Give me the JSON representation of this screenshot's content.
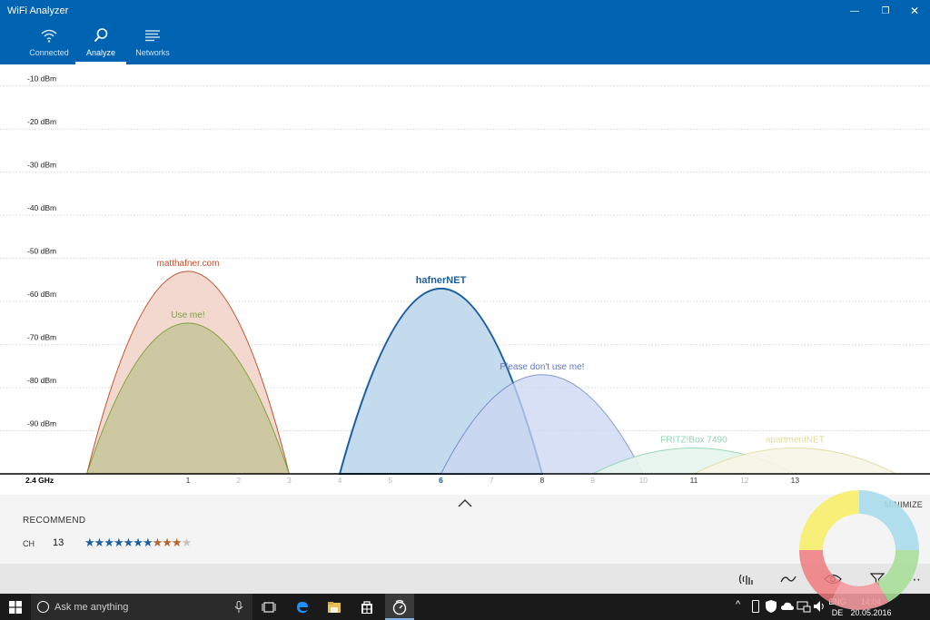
{
  "window": {
    "title": "WiFi Analyzer",
    "minimize_glyph": "—",
    "restore_glyph": "❐",
    "close_glyph": "✕"
  },
  "nav": {
    "tabs": [
      {
        "label": "Connected",
        "icon": "wifi-icon"
      },
      {
        "label": "Analyze",
        "icon": "magnifier-icon"
      },
      {
        "label": "Networks",
        "icon": "list-icon"
      }
    ],
    "active": "Analyze"
  },
  "chart_data": {
    "type": "area",
    "band_label": "2.4 GHz",
    "y_ticks": [
      "-10 dBm",
      "-20 dBm",
      "-30 dBm",
      "-40 dBm",
      "-50 dBm",
      "-60 dBm",
      "-70 dBm",
      "-80 dBm",
      "-90 dBm"
    ],
    "y_values": [
      -10,
      -20,
      -30,
      -40,
      -50,
      -60,
      -70,
      -80,
      -90
    ],
    "ylim": [
      -100,
      -5
    ],
    "x_ticks": [
      "1",
      "2",
      "3",
      "4",
      "5",
      "6",
      "7",
      "8",
      "9",
      "10",
      "11",
      "12",
      "13"
    ],
    "highlight_channel": "6",
    "grid": true,
    "series": [
      {
        "name": "matthafner.com",
        "channel": 1,
        "width": 4,
        "signal": -53,
        "color": "#c0522f",
        "fill": "#f2d8ce",
        "opacity": 1,
        "bold": false
      },
      {
        "name": "Use me!",
        "channel": 1,
        "width": 4,
        "signal": -65,
        "color": "#7ea23e",
        "fill": "#cdc8a2",
        "opacity": 1,
        "bold": false
      },
      {
        "name": "hafnerNET",
        "channel": 6,
        "width": 4,
        "signal": -57,
        "color": "#1b5fa0",
        "fill": "#c4dbee",
        "opacity": 1,
        "bold": true
      },
      {
        "name": "Please don't use me!",
        "channel": 8,
        "width": 4,
        "signal": -77,
        "color": "#5d76c4",
        "fill": "#ccd6f3",
        "opacity": 0.75,
        "bold": false
      },
      {
        "name": "FRITZ!Box 7490",
        "channel": 11,
        "width": 4,
        "signal": -94,
        "color": "#8fd3b0",
        "fill": "#e7f6ee",
        "opacity": 0.9,
        "bold": false
      },
      {
        "name": "apartmentNET",
        "channel": 13,
        "width": 4,
        "signal": -94,
        "color": "#e0dba4",
        "fill": "#f8f6e6",
        "opacity": 0.9,
        "bold": false
      }
    ]
  },
  "panel": {
    "minimize_label": "MINIMIZE",
    "recommend_label": "RECOMMEND",
    "ch_label": "CH",
    "ch_value": "13",
    "rating": {
      "blue": 7,
      "orange": 3,
      "gray": 1,
      "max": 11
    },
    "colors": {
      "blue": "#1b5fa0",
      "orange": "#b5652b",
      "gray": "#c4c4c4"
    }
  },
  "toolbar": {
    "icons": [
      "signal-bars-icon",
      "wave-icon",
      "eye-icon",
      "filter-icon",
      "more-icon"
    ],
    "more_glyph": "⋯"
  },
  "taskbar": {
    "search_placeholder": "Ask me anything",
    "language_top": "ENG",
    "language_bottom": "DE",
    "time": "14:04",
    "date": "20.05.2016"
  }
}
